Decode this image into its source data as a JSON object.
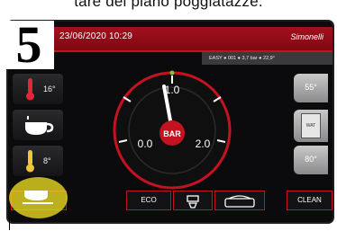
{
  "caption": "tare del piano poggiatazze.",
  "step_number": "5",
  "header": {
    "datetime": "23/06/2020 10:29",
    "brand": "Simonelli"
  },
  "status_bar": "EASY ● 001 ● 3,7 bar ● 22,9°",
  "left_panel": {
    "boiler_temp": "16°",
    "cup_temp": "8°"
  },
  "right_panel": {
    "temp_top": "55°",
    "cartridge_label": "WAT",
    "temp_bottom": "80°"
  },
  "gauge": {
    "unit": "BAR",
    "scale_min": "0.0",
    "scale_mid": "1.0",
    "scale_max": "2.0",
    "value": 1.0
  },
  "bottom_bar": {
    "eco_label": "ECO",
    "clean_label": "CLEAN"
  },
  "colors": {
    "accent": "#c41320",
    "highlight": "#ecdc23",
    "bg": "#0b0b0d"
  }
}
